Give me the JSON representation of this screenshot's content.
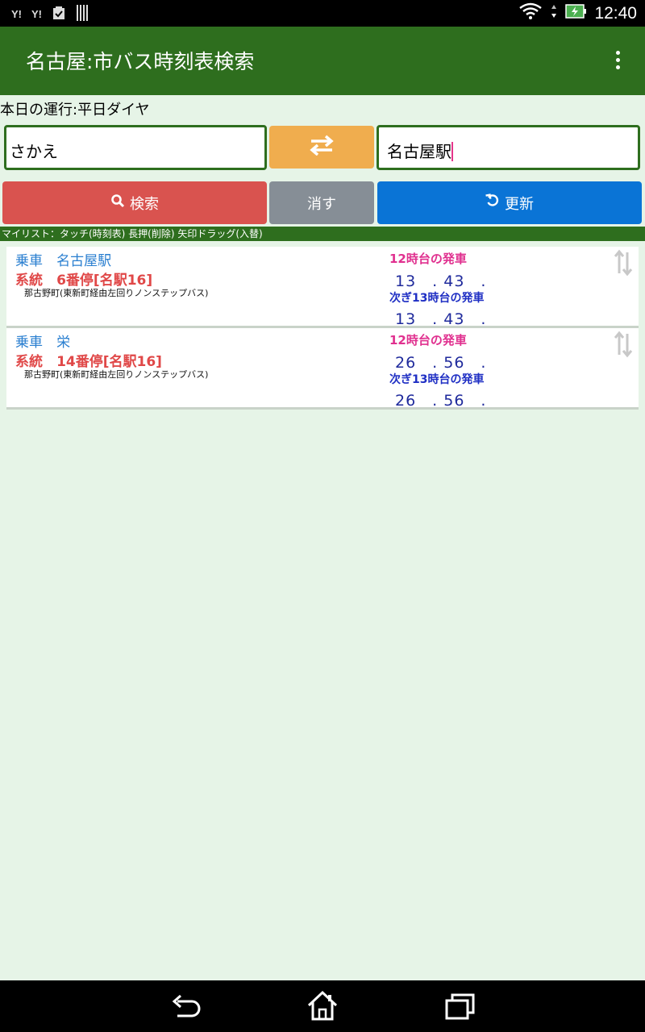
{
  "status_bar": {
    "left_icons": [
      "yahoo-icon",
      "yahoo-icon",
      "clipboard-icon",
      "barcode-icon"
    ],
    "left_labels": [
      "Y!",
      "Y!"
    ],
    "time": "12:40"
  },
  "app": {
    "title": "名古屋:市バス時刻表検索"
  },
  "operation_info": "本日の運行:平日ダイヤ",
  "search": {
    "from_value": "さかえ",
    "to_value": "名古屋駅"
  },
  "buttons": {
    "search": "検索",
    "clear": "消す",
    "refresh": "更新"
  },
  "mylist_hint": "マイリスト：タッチ(時刻表) 長押(削除) 矢印ドラッグ(入替)",
  "results": [
    {
      "board_label": "乗車",
      "board_stop": "名古屋駅",
      "line_label": "系統",
      "line_stop": "6番停[名駅16]",
      "route": "那古野町(東新町経由左回りノンステップバス)",
      "hour_header": "12時台の発車",
      "hour_times": "13　. 43　.",
      "next_header": "次ぎ13時台の発車",
      "next_times": "13　. 43　."
    },
    {
      "board_label": "乗車",
      "board_stop": "栄",
      "line_label": "系統",
      "line_stop": "14番停[名駅16]",
      "route": "那古野町(東新町経由左回りノンステップバス)",
      "hour_header": "12時台の発車",
      "hour_times": "26　. 56　.",
      "next_header": "次ぎ13時台の発車",
      "next_times": "26　. 56　."
    }
  ],
  "colors": {
    "appbar": "#2e6e1e",
    "background": "#e6f4e7",
    "search_button": "#d9534f",
    "clear_button": "#868e96",
    "refresh_button": "#0a74d6",
    "swap_button": "#f0ad4e"
  }
}
